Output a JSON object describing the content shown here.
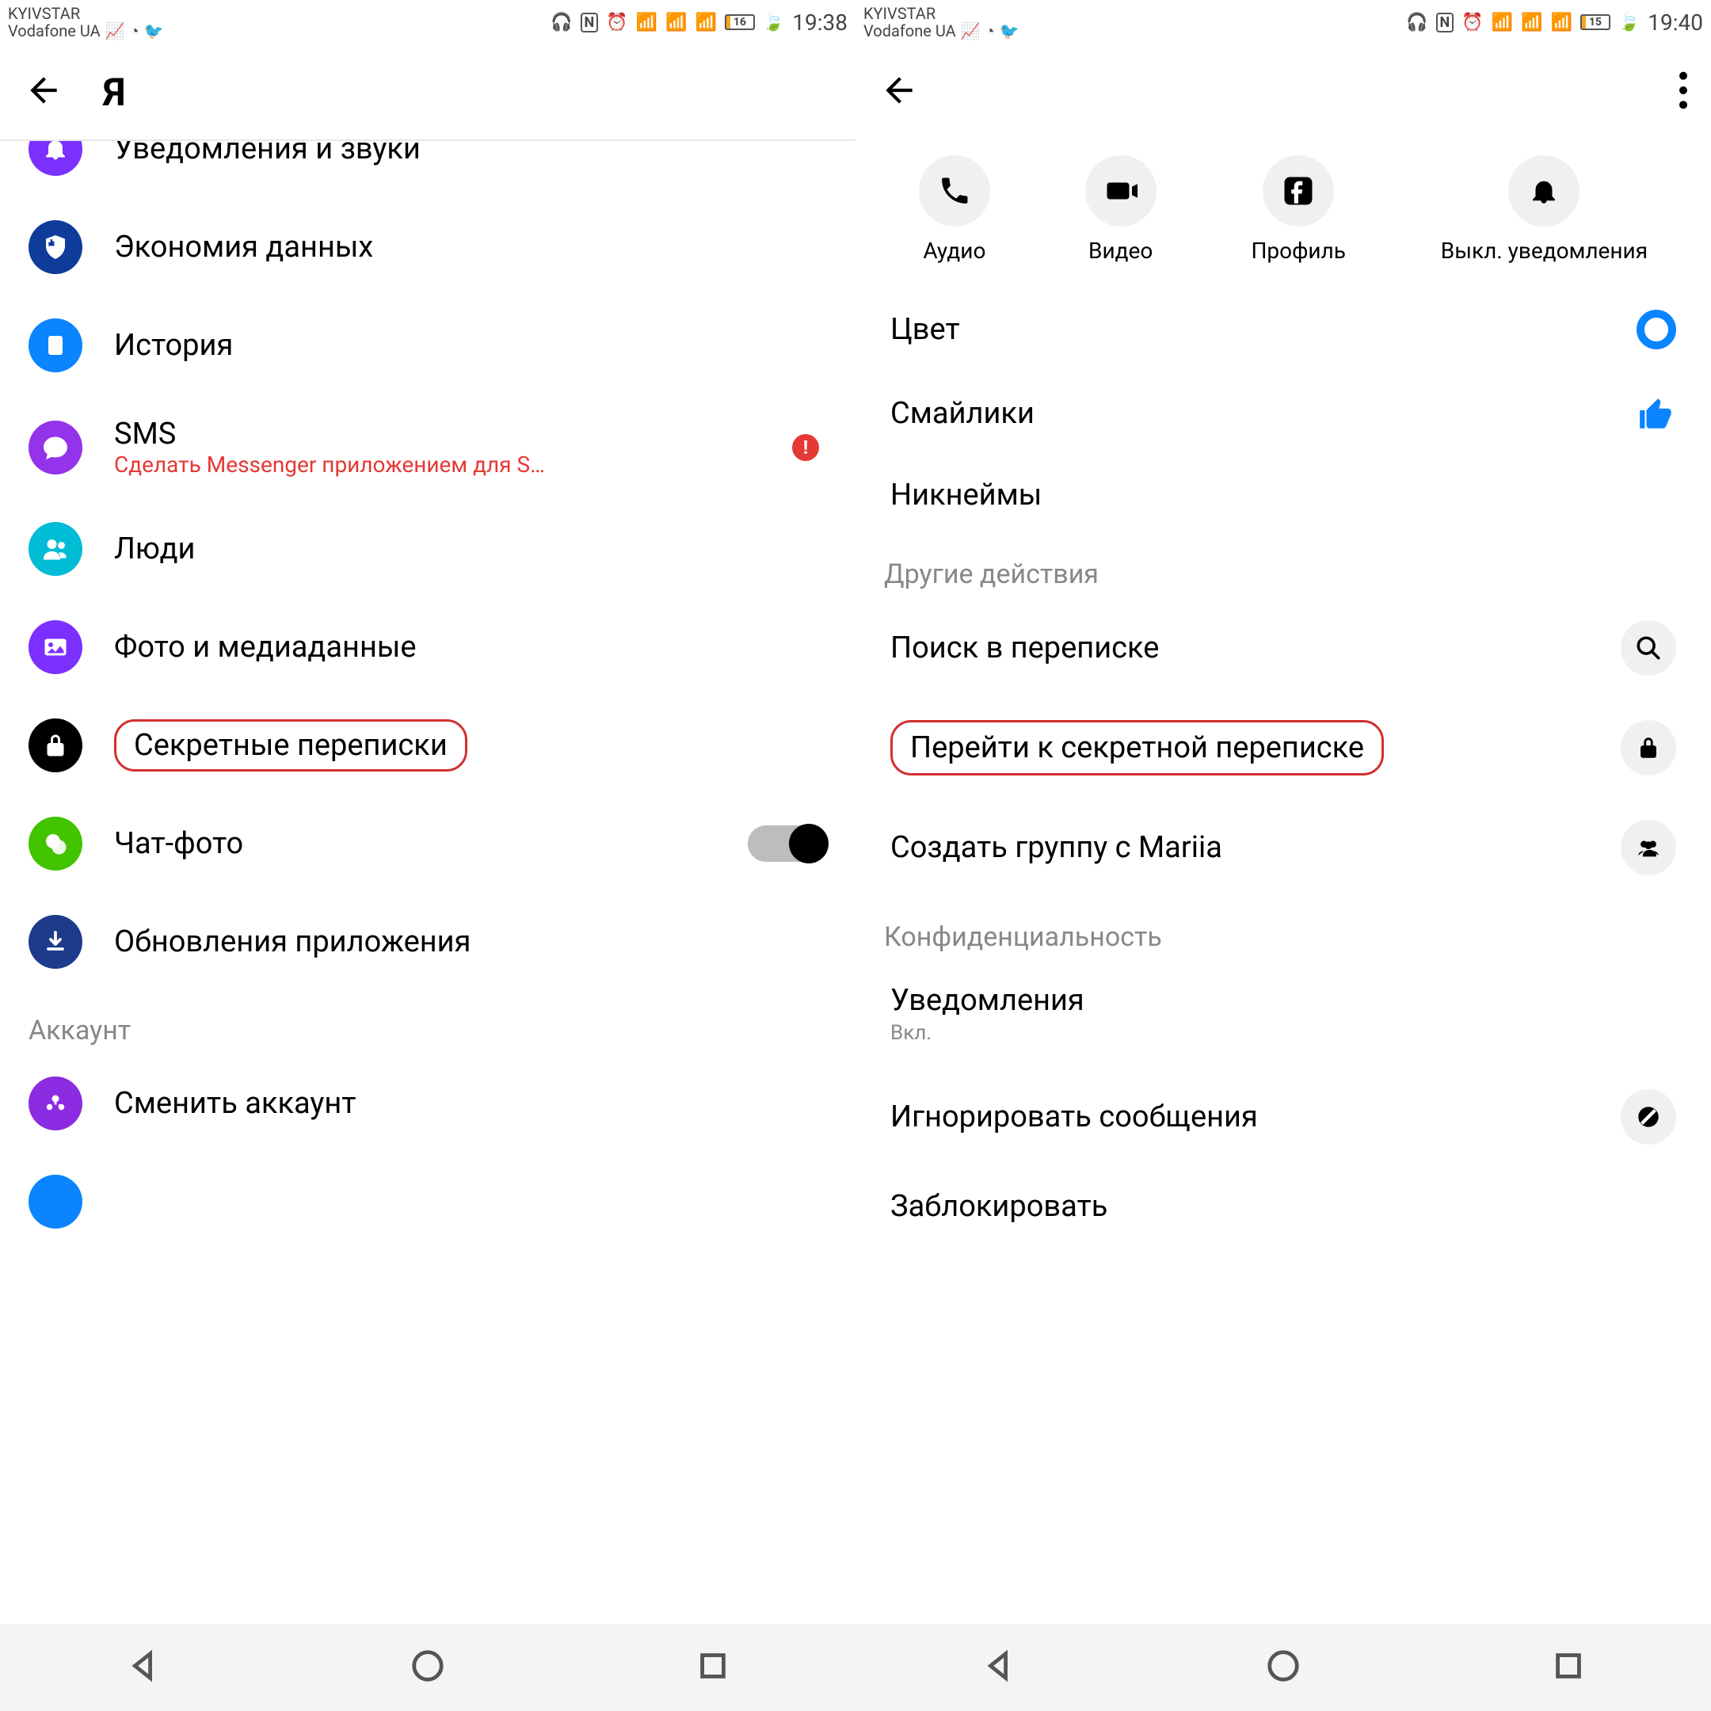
{
  "left": {
    "status": {
      "carrier1": "KYIVSTAR",
      "carrier2": "Vodafone UA",
      "battery": "16",
      "time": "19:38"
    },
    "title": "Я",
    "items": [
      {
        "label": "Уведомления и звуки",
        "color": "bg-purple",
        "icon": "bell",
        "cut": true
      },
      {
        "label": "Экономия данных",
        "color": "bg-darkblue",
        "icon": "shield"
      },
      {
        "label": "История",
        "color": "bg-blue",
        "icon": "square"
      },
      {
        "label": "SMS",
        "sub": "Сделать Messenger приложением для S…",
        "color": "bg-purple2",
        "icon": "chat",
        "warn": true
      },
      {
        "label": "Люди",
        "color": "bg-cyan",
        "icon": "people"
      },
      {
        "label": "Фото и медиаданные",
        "color": "bg-purple",
        "icon": "photo"
      },
      {
        "label": "Секретные переписки",
        "color": "bg-black",
        "icon": "lock",
        "highlight": true
      },
      {
        "label": "Чат-фото",
        "color": "bg-green",
        "icon": "circles",
        "toggle": true
      },
      {
        "label": "Обновления приложения",
        "color": "bg-navy",
        "icon": "download"
      }
    ],
    "section": "Аккаунт",
    "account_item": {
      "label": "Сменить аккаунт",
      "color": "bg-violet",
      "icon": "switch"
    }
  },
  "right": {
    "status": {
      "carrier1": "KYIVSTAR",
      "carrier2": "Vodafone UA",
      "battery": "15",
      "time": "19:40"
    },
    "quick": [
      {
        "label": "Аудио",
        "icon": "phone"
      },
      {
        "label": "Видео",
        "icon": "video"
      },
      {
        "label": "Профиль",
        "icon": "fb"
      },
      {
        "label": "Выкл. уведомления",
        "icon": "bell"
      }
    ],
    "rows1": [
      {
        "label": "Цвет",
        "right": "color-dot"
      },
      {
        "label": "Смайлики",
        "right": "thumb"
      },
      {
        "label": "Никнеймы",
        "right": ""
      }
    ],
    "sec1": "Другие действия",
    "rows2": [
      {
        "label": "Поиск в переписке",
        "right": "search"
      },
      {
        "label": "Перейти к секретной переписке",
        "right": "lock",
        "highlight": true
      },
      {
        "label": "Создать группу с Mariia",
        "right": "group"
      }
    ],
    "sec2": "Конфиденциальность",
    "rows3": [
      {
        "label": "Уведомления",
        "sub": "Вкл.",
        "right": ""
      },
      {
        "label": "Игнорировать сообщения",
        "right": "block"
      },
      {
        "label": "Заблокировать",
        "right": ""
      }
    ]
  }
}
